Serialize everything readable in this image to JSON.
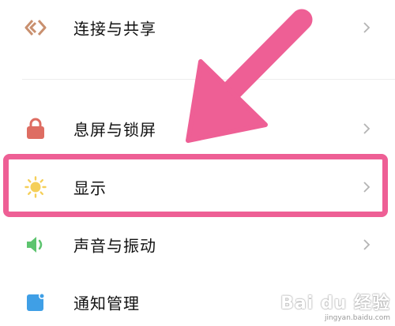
{
  "settings_items": [
    {
      "label": "连接与共享",
      "icon": "share-connect-icon",
      "icon_color": "#c9906f"
    },
    {
      "label": "息屏与锁屏",
      "icon": "lock-icon",
      "icon_color": "#de6d62"
    },
    {
      "label": "显示",
      "icon": "sun-icon",
      "icon_color": "#f5cf59"
    },
    {
      "label": "声音与振动",
      "icon": "speaker-icon",
      "icon_color": "#5dc46f"
    },
    {
      "label": "通知管理",
      "icon": "notification-icon",
      "icon_color": "#3f9fe6"
    }
  ],
  "highlight_color": "#ee5f95",
  "watermark": {
    "brand": "Bai du 经验",
    "url": "jingyan.baidu.com"
  }
}
